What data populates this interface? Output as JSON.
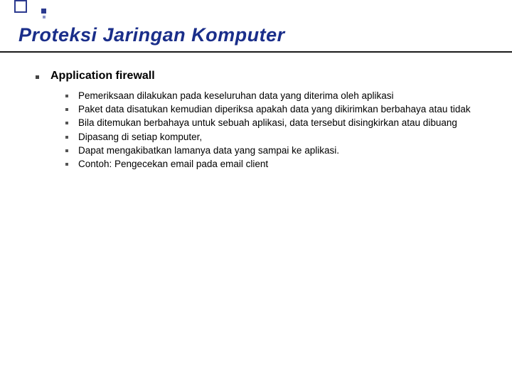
{
  "title": "Proteksi Jaringan Komputer",
  "section": {
    "heading": "Application firewall",
    "items": [
      "Pemeriksaan dilakukan pada keseluruhan data yang diterima oleh aplikasi",
      "Paket data disatukan kemudian diperiksa apakah data yang dikirimkan berbahaya atau tidak",
      "Bila ditemukan berbahaya untuk sebuah aplikasi, data tersebut disingkirkan atau dibuang",
      "Dipasang di setiap komputer,",
      "Dapat mengakibatkan lamanya data yang sampai ke aplikasi.",
      "Contoh: Pengecekan email pada email client"
    ]
  }
}
